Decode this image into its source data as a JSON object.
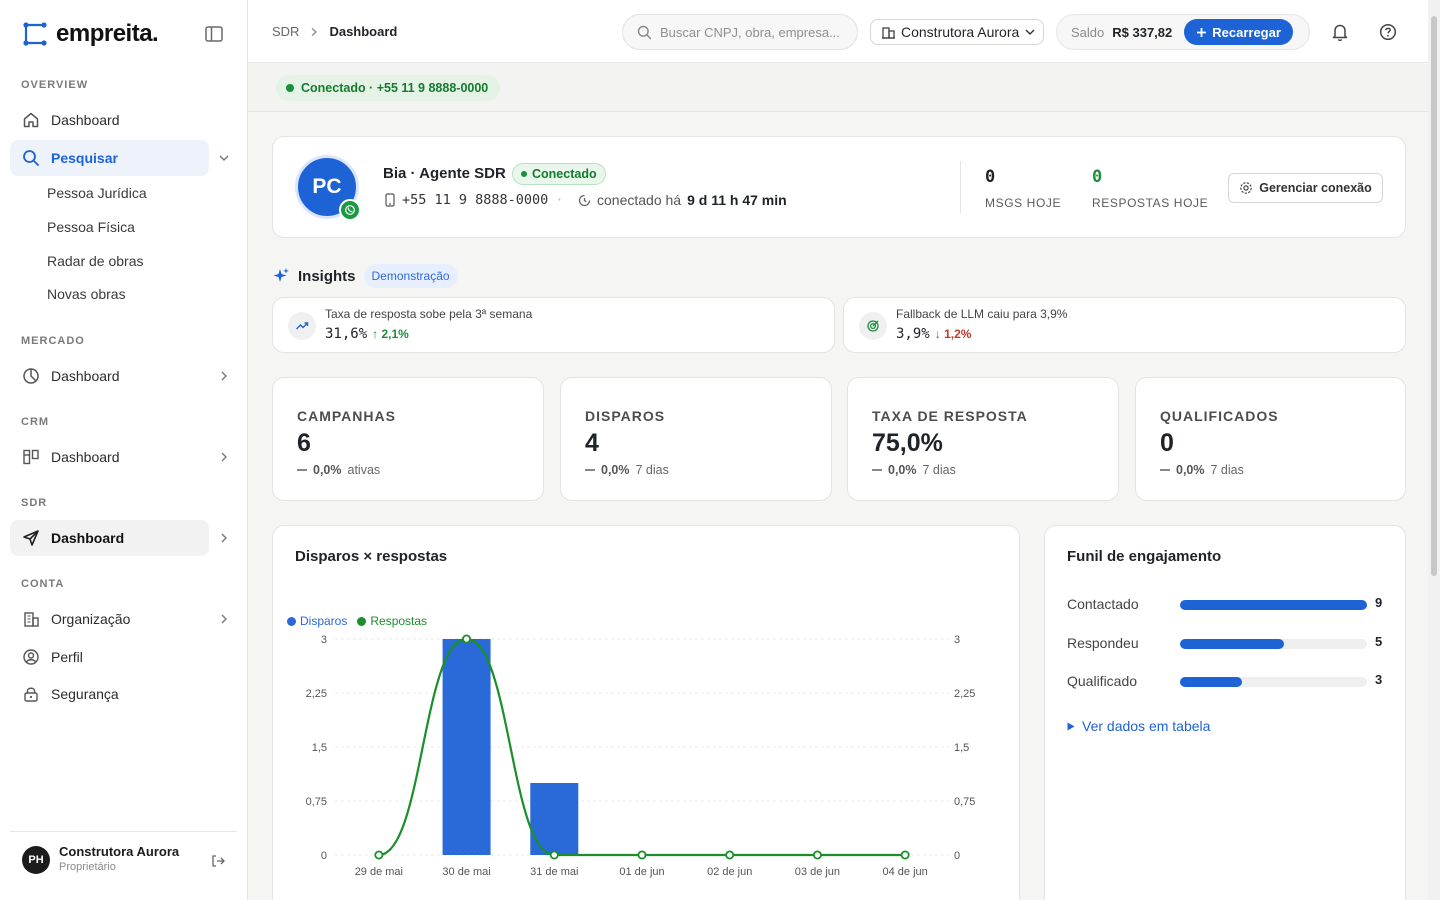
{
  "brand": {
    "name": "empreita."
  },
  "sidebar": {
    "sections": {
      "overview": "OVERVIEW",
      "mercado": "MERCADO",
      "crm": "CRM",
      "sdr": "SDR",
      "conta": "CONTA"
    },
    "items": {
      "overview_dashboard": "Dashboard",
      "pesquisar": "Pesquisar",
      "pessoa_juridica": "Pessoa Jurídica",
      "pessoa_fisica": "Pessoa Física",
      "radar_obras": "Radar de obras",
      "novas_obras": "Novas obras",
      "mercado_dashboard": "Dashboard",
      "crm_dashboard": "Dashboard",
      "sdr_dashboard": "Dashboard",
      "organizacao": "Organização",
      "perfil": "Perfil",
      "seguranca": "Segurança"
    },
    "user": {
      "initials": "PH",
      "name": "Construtora Aurora",
      "role": "Proprietário"
    }
  },
  "topbar": {
    "breadcrumb": [
      "SDR",
      "Dashboard"
    ],
    "search_placeholder": "Buscar CNPJ, obra, empresa...",
    "org_selected": "Construtora Aurora",
    "balance_label": "Saldo",
    "balance_value": "R$ 337,82",
    "recharge_label": "Recarregar"
  },
  "status": {
    "connection": "Conectado · +55 11 9 8888-0000"
  },
  "agent": {
    "initials": "PC",
    "name": "Bia · Agente SDR",
    "badge": "Conectado",
    "phone": "+55 11 9 8888-0000",
    "connected_prefix": "conectado há",
    "connected_duration": "9 d 11 h 47 min",
    "msgs_today_value": "0",
    "msgs_today_label": "MSGS HOJE",
    "replies_today_value": "0",
    "replies_today_label": "RESPOSTAS HOJE",
    "manage_label": "Gerenciar conexão"
  },
  "insights": {
    "title": "Insights",
    "badge": "Demonstração",
    "cards": [
      {
        "text": "Taxa de resposta sobe pela 3ª semana",
        "value": "31,6%",
        "delta": "2,1%",
        "direction": "up"
      },
      {
        "text": "Fallback de LLM caiu para 3,9%",
        "value": "3,9%",
        "delta": "1,2%",
        "direction": "down"
      }
    ]
  },
  "kpis": [
    {
      "label": "CAMPANHAS",
      "value": "6",
      "delta": "0,0%",
      "note": "ativas"
    },
    {
      "label": "DISPAROS",
      "value": "4",
      "delta": "0,0%",
      "note": "7 dias"
    },
    {
      "label": "TAXA DE RESPOSTA",
      "value": "75,0%",
      "delta": "0,0%",
      "note": "7 dias"
    },
    {
      "label": "QUALIFICADOS",
      "value": "0",
      "delta": "0,0%",
      "note": "7 dias"
    }
  ],
  "chart": {
    "title": "Disparos × respostas"
  },
  "chart_data": {
    "type": "bar",
    "categories": [
      "29 de mai",
      "30 de mai",
      "31 de mai",
      "01 de jun",
      "02 de jun",
      "03 de jun",
      "04 de jun"
    ],
    "series": [
      {
        "name": "Disparos",
        "type": "bar",
        "values": [
          0,
          3,
          1,
          0,
          0,
          0,
          0
        ],
        "color": "#2a6ad8"
      },
      {
        "name": "Respostas",
        "type": "line",
        "values": [
          0,
          3,
          0,
          0,
          0,
          0,
          0
        ],
        "color": "#1a8f2a"
      }
    ],
    "ylim": [
      0,
      3
    ],
    "yticks": [
      "0",
      "0,75",
      "1,5",
      "2,25",
      "3"
    ],
    "y2ticks": [
      "0",
      "0,75",
      "1,5",
      "2,25",
      "3"
    ],
    "legend": "top-left",
    "grid": true
  },
  "funnel": {
    "title": "Funil de engajamento",
    "rows": [
      {
        "label": "Contactado",
        "value": 9
      },
      {
        "label": "Respondeu",
        "value": 5
      },
      {
        "label": "Qualificado",
        "value": 3
      }
    ],
    "max": 9,
    "table_link": "Ver dados em tabela"
  },
  "colors": {
    "accent": "#1d63d6",
    "success": "#1a8f3a",
    "danger": "#c0392b"
  }
}
